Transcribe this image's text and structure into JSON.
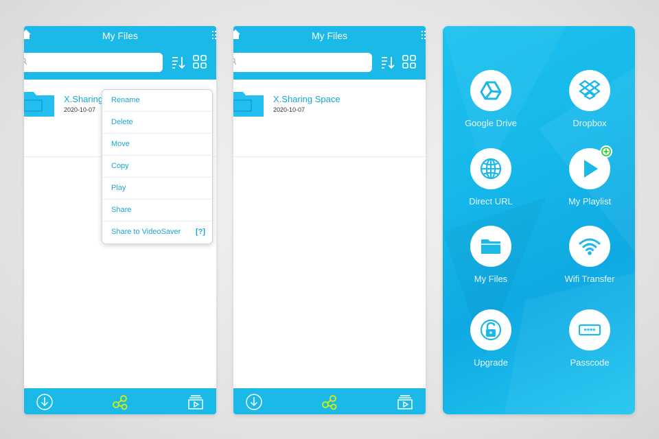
{
  "colors": {
    "accent": "#1ab9e8",
    "link_text": "#18a5d6",
    "highlight_icon": "#d8f000",
    "badge_green": "#2ecc40"
  },
  "screen1": {
    "title": "My Files",
    "file": {
      "name": "X.Sharing",
      "date": "2020-10-07"
    },
    "context_menu": {
      "items": [
        "Rename",
        "Delete",
        "Move",
        "Copy",
        "Play",
        "Share",
        "Share to VideoSaver"
      ],
      "help_label": "[?]"
    }
  },
  "screen2": {
    "title": "My Files",
    "file": {
      "name": "X.Sharing Space",
      "date": "2020-10-07"
    }
  },
  "screen3": {
    "tiles": [
      {
        "label": "Google Drive",
        "icon": "google-drive-icon"
      },
      {
        "label": "Dropbox",
        "icon": "dropbox-icon"
      },
      {
        "label": "Direct URL",
        "icon": "globe-icon"
      },
      {
        "label": "My Playlist",
        "icon": "play-icon"
      },
      {
        "label": "My Files",
        "icon": "folder-icon"
      },
      {
        "label": "Wifi Transfer",
        "icon": "wifi-icon"
      },
      {
        "label": "Upgrade",
        "icon": "unlock-icon"
      },
      {
        "label": "Passcode",
        "icon": "passcode-icon"
      }
    ],
    "passcode_mask": "****"
  },
  "icons": {
    "bottom_bar": [
      "download-icon",
      "share-nodes-icon",
      "playlist-video-icon"
    ],
    "toolbar": [
      "search-icon",
      "sort-icon",
      "grid-view-icon"
    ],
    "titlebar": [
      "home-icon",
      "menu-icon"
    ]
  }
}
